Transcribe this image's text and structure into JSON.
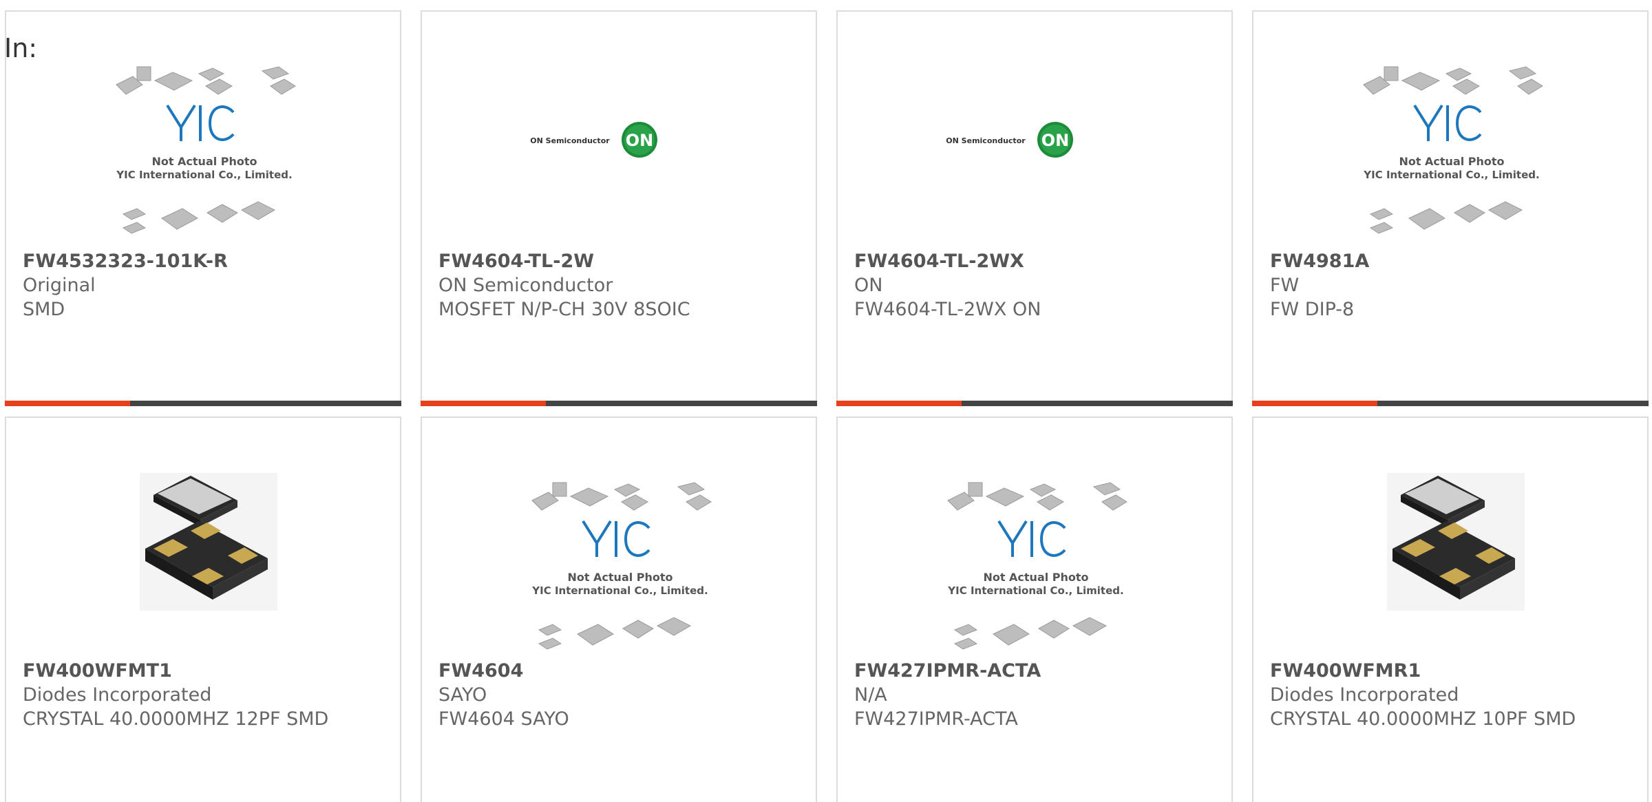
{
  "filter_label": "In:",
  "accent_color": "#e8401c",
  "bar_color": "#444444",
  "cards": [
    {
      "part": "FW4532323-101K-R",
      "maker": "Original",
      "desc": "SMD",
      "image": "yic-placeholder",
      "yic_caption_1": "Not Actual Photo",
      "yic_caption_2": "YIC International Co., Limited."
    },
    {
      "part": "FW4604-TL-2W",
      "maker": "ON Semiconductor",
      "desc": "MOSFET N/P-CH 30V 8SOIC",
      "image": "on-semi-logo",
      "logo_text": "ON Semiconductor",
      "logo_badge": "ON"
    },
    {
      "part": "FW4604-TL-2WX",
      "maker": "ON",
      "desc": "FW4604-TL-2WX ON",
      "image": "on-semi-logo",
      "logo_text": "ON Semiconductor",
      "logo_badge": "ON"
    },
    {
      "part": "FW4981A",
      "maker": "FW",
      "desc": "FW DIP-8",
      "image": "yic-placeholder",
      "yic_caption_1": "Not Actual Photo",
      "yic_caption_2": "YIC International Co., Limited."
    },
    {
      "part": "FW400WFMT1",
      "maker": "Diodes Incorporated",
      "desc": "CRYSTAL 40.0000MHZ 12PF SMD",
      "image": "crystal-photo"
    },
    {
      "part": "FW4604",
      "maker": "SAYO",
      "desc": "FW4604 SAYO",
      "image": "yic-placeholder",
      "yic_caption_1": "Not Actual Photo",
      "yic_caption_2": "YIC International Co., Limited."
    },
    {
      "part": "FW427IPMR-ACTA",
      "maker": "N/A",
      "desc": "FW427IPMR-ACTA",
      "image": "yic-placeholder",
      "yic_caption_1": "Not Actual Photo",
      "yic_caption_2": "YIC International Co., Limited."
    },
    {
      "part": "FW400WFMR1",
      "maker": "Diodes Incorporated",
      "desc": "CRYSTAL 40.0000MHZ 10PF SMD",
      "image": "crystal-photo"
    }
  ]
}
